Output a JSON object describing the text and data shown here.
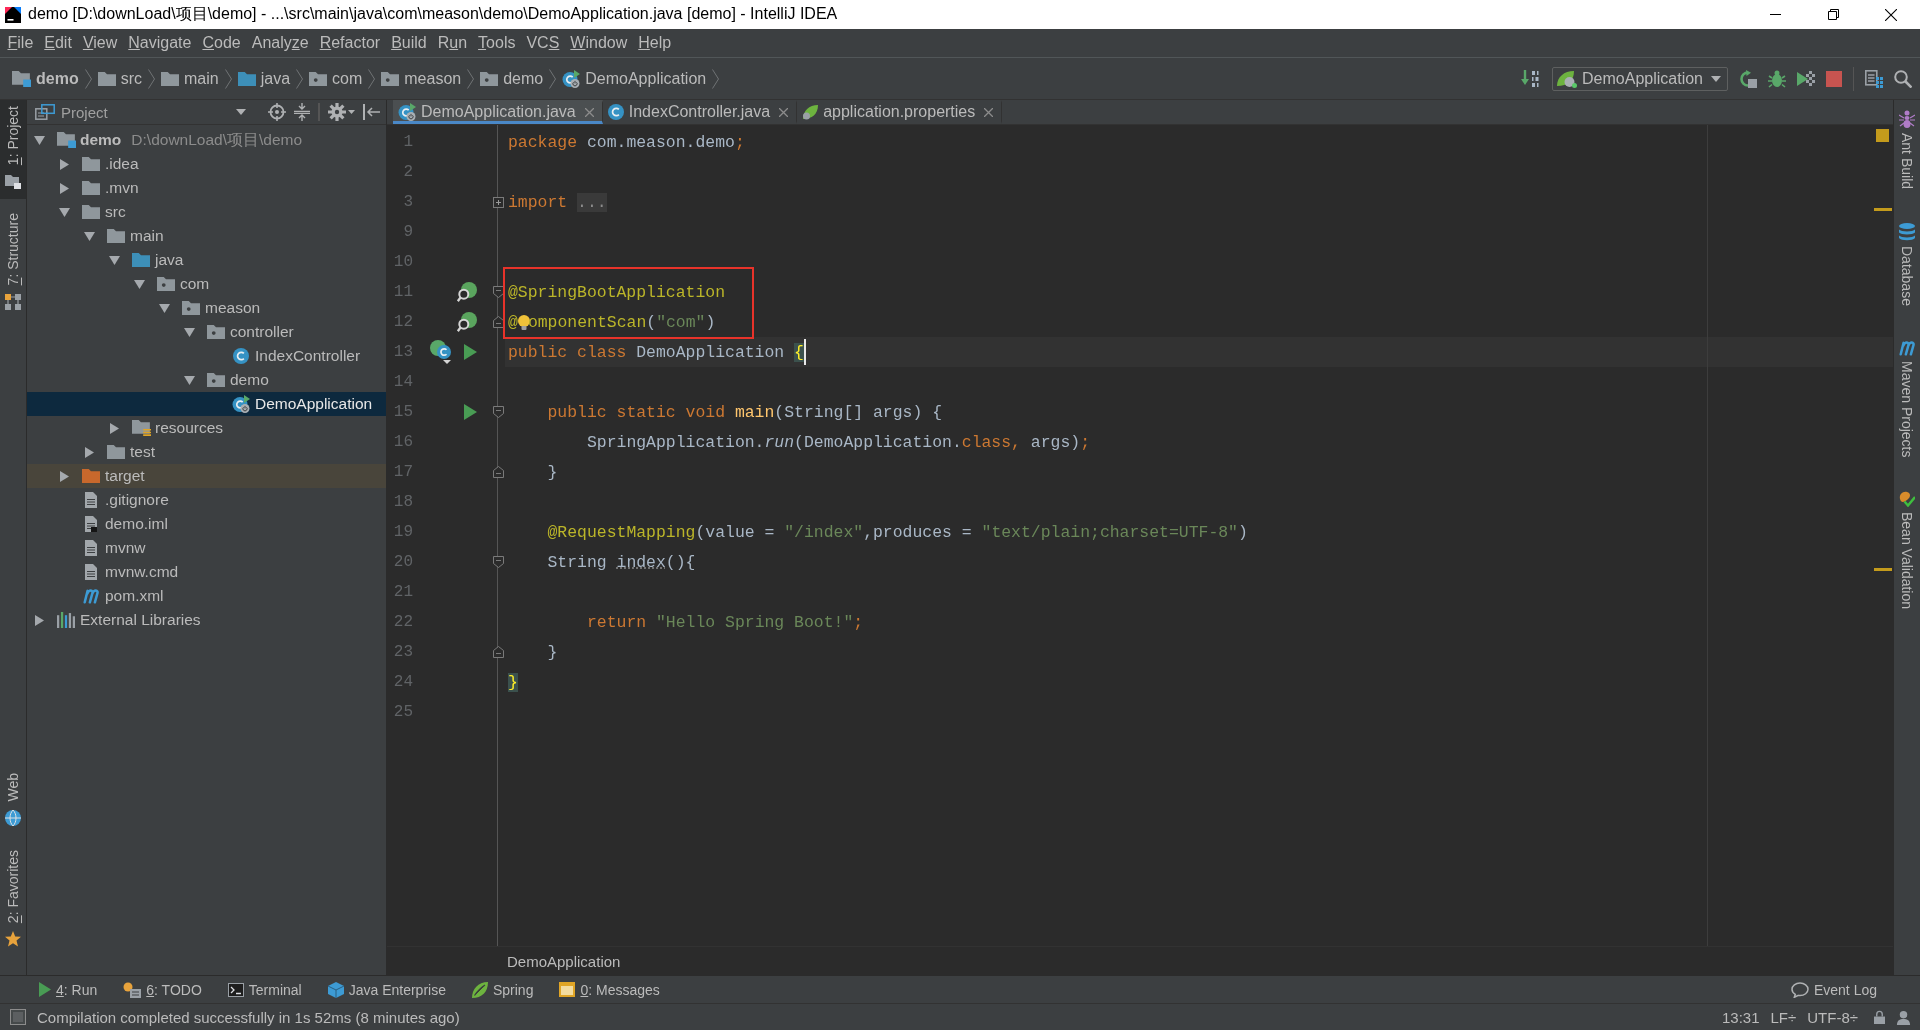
{
  "window": {
    "title": "demo [D:\\downLoad\\项目\\demo] - ...\\src\\main\\java\\com\\meason\\demo\\DemoApplication.java [demo] - IntelliJ IDEA"
  },
  "menu": [
    {
      "mnemonic": "F",
      "after": "ile"
    },
    {
      "mnemonic": "E",
      "after": "dit"
    },
    {
      "mnemonic": "V",
      "after": "iew"
    },
    {
      "mnemonic": "N",
      "after": "avigate"
    },
    {
      "mnemonic": "C",
      "after": "ode"
    },
    {
      "before": "Analy",
      "mnemonic": "z",
      "after": "e"
    },
    {
      "mnemonic": "R",
      "after": "efactor"
    },
    {
      "mnemonic": "B",
      "after": "uild"
    },
    {
      "before": "R",
      "mnemonic": "u",
      "after": "n"
    },
    {
      "mnemonic": "T",
      "after": "ools"
    },
    {
      "before": "VC",
      "mnemonic": "S"
    },
    {
      "mnemonic": "W",
      "after": "indow"
    },
    {
      "mnemonic": "H",
      "after": "elp"
    }
  ],
  "navigation_bar": {
    "items": [
      {
        "label": "demo",
        "kind": "module"
      },
      {
        "label": "src",
        "kind": "folder"
      },
      {
        "label": "main",
        "kind": "folder"
      },
      {
        "label": "java",
        "kind": "source_folder"
      },
      {
        "label": "com",
        "kind": "package"
      },
      {
        "label": "meason",
        "kind": "package"
      },
      {
        "label": "demo",
        "kind": "package"
      },
      {
        "label": "DemoApplication",
        "kind": "spring_class"
      }
    ],
    "run_configuration": "DemoApplication"
  },
  "left_stripe": {
    "top": [
      {
        "mnemonic": "1",
        "after": ": Project",
        "kind": "project",
        "selected": true
      },
      {
        "mnemonic": "7",
        "after": ": Structure",
        "kind": "structure",
        "selected": false
      }
    ],
    "bottom": [
      {
        "label": "Web",
        "kind": "web",
        "selected": false
      },
      {
        "mnemonic": "2",
        "after": ": Favorites",
        "kind": "favorites",
        "selected": false
      }
    ]
  },
  "project_panel": {
    "title": "Project",
    "tree": [
      {
        "label": "demo",
        "kind": "module",
        "hint": "D:\\downLoad\\项目\\demo",
        "expanded": true,
        "selected": false,
        "children": [
          {
            "label": ".idea",
            "kind": "folder",
            "expanded": false,
            "selected": false
          },
          {
            "label": ".mvn",
            "kind": "folder",
            "expanded": false,
            "selected": false
          },
          {
            "label": "src",
            "kind": "folder",
            "expanded": true,
            "selected": false,
            "children": [
              {
                "label": "main",
                "kind": "folder",
                "expanded": true,
                "selected": false,
                "children": [
                  {
                    "label": "java",
                    "kind": "source_folder",
                    "expanded": true,
                    "selected": false,
                    "children": [
                      {
                        "label": "com",
                        "kind": "package",
                        "expanded": true,
                        "selected": false,
                        "children": [
                          {
                            "label": "meason",
                            "kind": "package",
                            "expanded": true,
                            "selected": false,
                            "children": [
                              {
                                "label": "controller",
                                "kind": "package",
                                "expanded": true,
                                "selected": false,
                                "children": [
                                  {
                                    "label": "IndexController",
                                    "kind": "class",
                                    "selected": false
                                  }
                                ]
                              },
                              {
                                "label": "demo",
                                "kind": "package",
                                "expanded": true,
                                "selected": false,
                                "children": [
                                  {
                                    "label": "DemoApplication",
                                    "kind": "spring_class",
                                    "selected": true
                                  }
                                ]
                              }
                            ]
                          }
                        ]
                      }
                    ]
                  },
                  {
                    "label": "resources",
                    "kind": "resources",
                    "expanded": false,
                    "selected": false
                  }
                ]
              },
              {
                "label": "test",
                "kind": "folder",
                "expanded": false,
                "selected": false
              }
            ]
          },
          {
            "label": "target",
            "kind": "excluded_folder",
            "expanded": false,
            "selected": false
          },
          {
            "label": ".gitignore",
            "kind": "file",
            "selected": false
          },
          {
            "label": "demo.iml",
            "kind": "iml",
            "selected": false
          },
          {
            "label": "mvnw",
            "kind": "file",
            "selected": false
          },
          {
            "label": "mvnw.cmd",
            "kind": "file",
            "selected": false
          },
          {
            "label": "pom.xml",
            "kind": "maven",
            "selected": false
          }
        ]
      },
      {
        "label": "External Libraries",
        "kind": "libraries",
        "expanded": false,
        "selected": false
      }
    ]
  },
  "editor": {
    "tabs": [
      {
        "label": "DemoApplication.java",
        "kind": "spring_class",
        "selected": true
      },
      {
        "label": "IndexController.java",
        "kind": "class",
        "selected": false
      },
      {
        "label": "application.properties",
        "kind": "properties",
        "selected": false
      }
    ],
    "lines": [
      {
        "number": "1",
        "current": false,
        "boxed": false,
        "intention": false,
        "tokens": [
          {
            "kind": "kw",
            "text": "package"
          },
          {
            "kind": "plain",
            "text": " com.meason.demo"
          },
          {
            "kind": "kw",
            "text": ";"
          }
        ]
      },
      {
        "number": "2",
        "current": false,
        "boxed": false,
        "intention": false
      },
      {
        "number": "3",
        "fold_marker": {
          "kind": "collapsed"
        },
        "current": false,
        "boxed": false,
        "intention": false,
        "tokens": [
          {
            "kind": "kw",
            "text": "import "
          },
          {
            "kind": "folded",
            "text": "..."
          }
        ]
      },
      {
        "number": "9",
        "current": false,
        "boxed": false,
        "intention": false
      },
      {
        "number": "10",
        "current": false,
        "boxed": false,
        "intention": false
      },
      {
        "number": "11",
        "gutter_icons": [
          {
            "kind": "bean"
          }
        ],
        "fold_marker": {
          "kind": "start"
        },
        "current": false,
        "boxed": true,
        "intention": false,
        "tokens": [
          {
            "kind": "ann",
            "text": "@SpringBootApplication"
          }
        ]
      },
      {
        "number": "12",
        "gutter_icons": [
          {
            "kind": "bean"
          }
        ],
        "fold_marker": {
          "kind": "end"
        },
        "current": false,
        "boxed": true,
        "intention": true,
        "tokens": [
          {
            "kind": "ann",
            "text": "@"
          },
          {
            "kind": "ann",
            "text": "omponentScan"
          },
          {
            "kind": "plain",
            "text": "("
          },
          {
            "kind": "str",
            "text": "\"com\""
          },
          {
            "kind": "plain",
            "text": ")"
          }
        ]
      },
      {
        "number": "13",
        "gutter_icons": [
          {
            "kind": "spring_class"
          },
          {
            "kind": "run"
          }
        ],
        "current": true,
        "boxed": false,
        "intention": false,
        "tokens": [
          {
            "kind": "kw",
            "text": "public class"
          },
          {
            "kind": "plain",
            "text": " DemoApplication "
          },
          {
            "kind": "brace",
            "text": "{"
          }
        ]
      },
      {
        "number": "14",
        "current": false,
        "boxed": false,
        "intention": false
      },
      {
        "number": "15",
        "gutter_icons": [
          {
            "kind": "run"
          }
        ],
        "fold_marker": {
          "kind": "start"
        },
        "current": false,
        "boxed": false,
        "intention": false,
        "tokens": [
          {
            "kind": "kw",
            "text": "    public static void "
          },
          {
            "kind": "decl",
            "text": "main"
          },
          {
            "kind": "plain",
            "text": "(String[] args) {"
          }
        ]
      },
      {
        "number": "16",
        "current": false,
        "boxed": false,
        "intention": false,
        "tokens": [
          {
            "kind": "plain",
            "text": "        SpringApplication."
          },
          {
            "kind": "static",
            "text": "run"
          },
          {
            "kind": "plain",
            "text": "(DemoApplication."
          },
          {
            "kind": "kw",
            "text": "class,"
          },
          {
            "kind": "plain",
            "text": " args)"
          },
          {
            "kind": "kw",
            "text": ";"
          }
        ]
      },
      {
        "number": "17",
        "fold_marker": {
          "kind": "end"
        },
        "current": false,
        "boxed": false,
        "intention": false,
        "tokens": [
          {
            "kind": "plain",
            "text": "    }"
          }
        ]
      },
      {
        "number": "18",
        "current": false,
        "boxed": false,
        "intention": false
      },
      {
        "number": "19",
        "current": false,
        "boxed": false,
        "intention": false,
        "tokens": [
          {
            "kind": "ann",
            "text": "    @RequestMapping"
          },
          {
            "kind": "plain",
            "text": "(value = "
          },
          {
            "kind": "str",
            "text": "\"/index\""
          },
          {
            "kind": "plain",
            "text": ",produces = "
          },
          {
            "kind": "str",
            "text": "\"text/plain;charset=UTF-8\""
          },
          {
            "kind": "plain",
            "text": ")"
          }
        ]
      },
      {
        "number": "20",
        "fold_marker": {
          "kind": "start"
        },
        "current": false,
        "boxed": false,
        "intention": false,
        "tokens": [
          {
            "kind": "plain",
            "text": "    String "
          },
          {
            "kind": "unused",
            "text": "index"
          },
          {
            "kind": "plain",
            "text": "(){"
          }
        ]
      },
      {
        "number": "21",
        "current": false,
        "boxed": false,
        "intention": false
      },
      {
        "number": "22",
        "current": false,
        "boxed": false,
        "intention": false,
        "tokens": [
          {
            "kind": "kw",
            "text": "        return "
          },
          {
            "kind": "str",
            "text": "\"Hello Spring Boot!\""
          },
          {
            "kind": "kw",
            "text": ";"
          }
        ]
      },
      {
        "number": "23",
        "fold_marker": {
          "kind": "end"
        },
        "current": false,
        "boxed": false,
        "intention": false,
        "tokens": [
          {
            "kind": "plain",
            "text": "    }"
          }
        ]
      },
      {
        "number": "24",
        "current": false,
        "boxed": false,
        "intention": false,
        "tokens": [
          {
            "kind": "brace",
            "text": "}"
          }
        ]
      },
      {
        "number": "25",
        "current": false,
        "boxed": false,
        "intention": false
      }
    ],
    "breadcrumb": "DemoApplication"
  },
  "right_stripe": [
    {
      "label": "Ant Build",
      "kind": "ant",
      "selected": false
    },
    {
      "label": "Database",
      "kind": "database",
      "selected": false
    },
    {
      "label": "Maven Projects",
      "kind": "maven",
      "selected": false
    },
    {
      "label": "Bean Validation",
      "kind": "bean_validation",
      "selected": false
    }
  ],
  "tool_window_bar": {
    "items": [
      {
        "mnemonic": "4",
        "after": ": Run",
        "kind": "run",
        "selected": false
      },
      {
        "mnemonic": "6",
        "after": ": TODO",
        "kind": "todo",
        "selected": false
      },
      {
        "label": "Terminal",
        "kind": "terminal",
        "selected": false
      },
      {
        "label": "Java Enterprise",
        "kind": "java_enterprise",
        "selected": false
      },
      {
        "label": "Spring",
        "kind": "spring",
        "selected": false
      },
      {
        "mnemonic": "0",
        "after": ": Messages",
        "kind": "messages",
        "selected": false
      }
    ],
    "event_log": {
      "label": "Event Log",
      "kind": "event_log",
      "selected": false
    }
  },
  "status_bar": {
    "message": "Compilation completed successfully in 1s 52ms (8 minutes ago)",
    "caret_position": "13:31",
    "line_separator": "LF÷",
    "encoding": "UTF-8÷"
  }
}
